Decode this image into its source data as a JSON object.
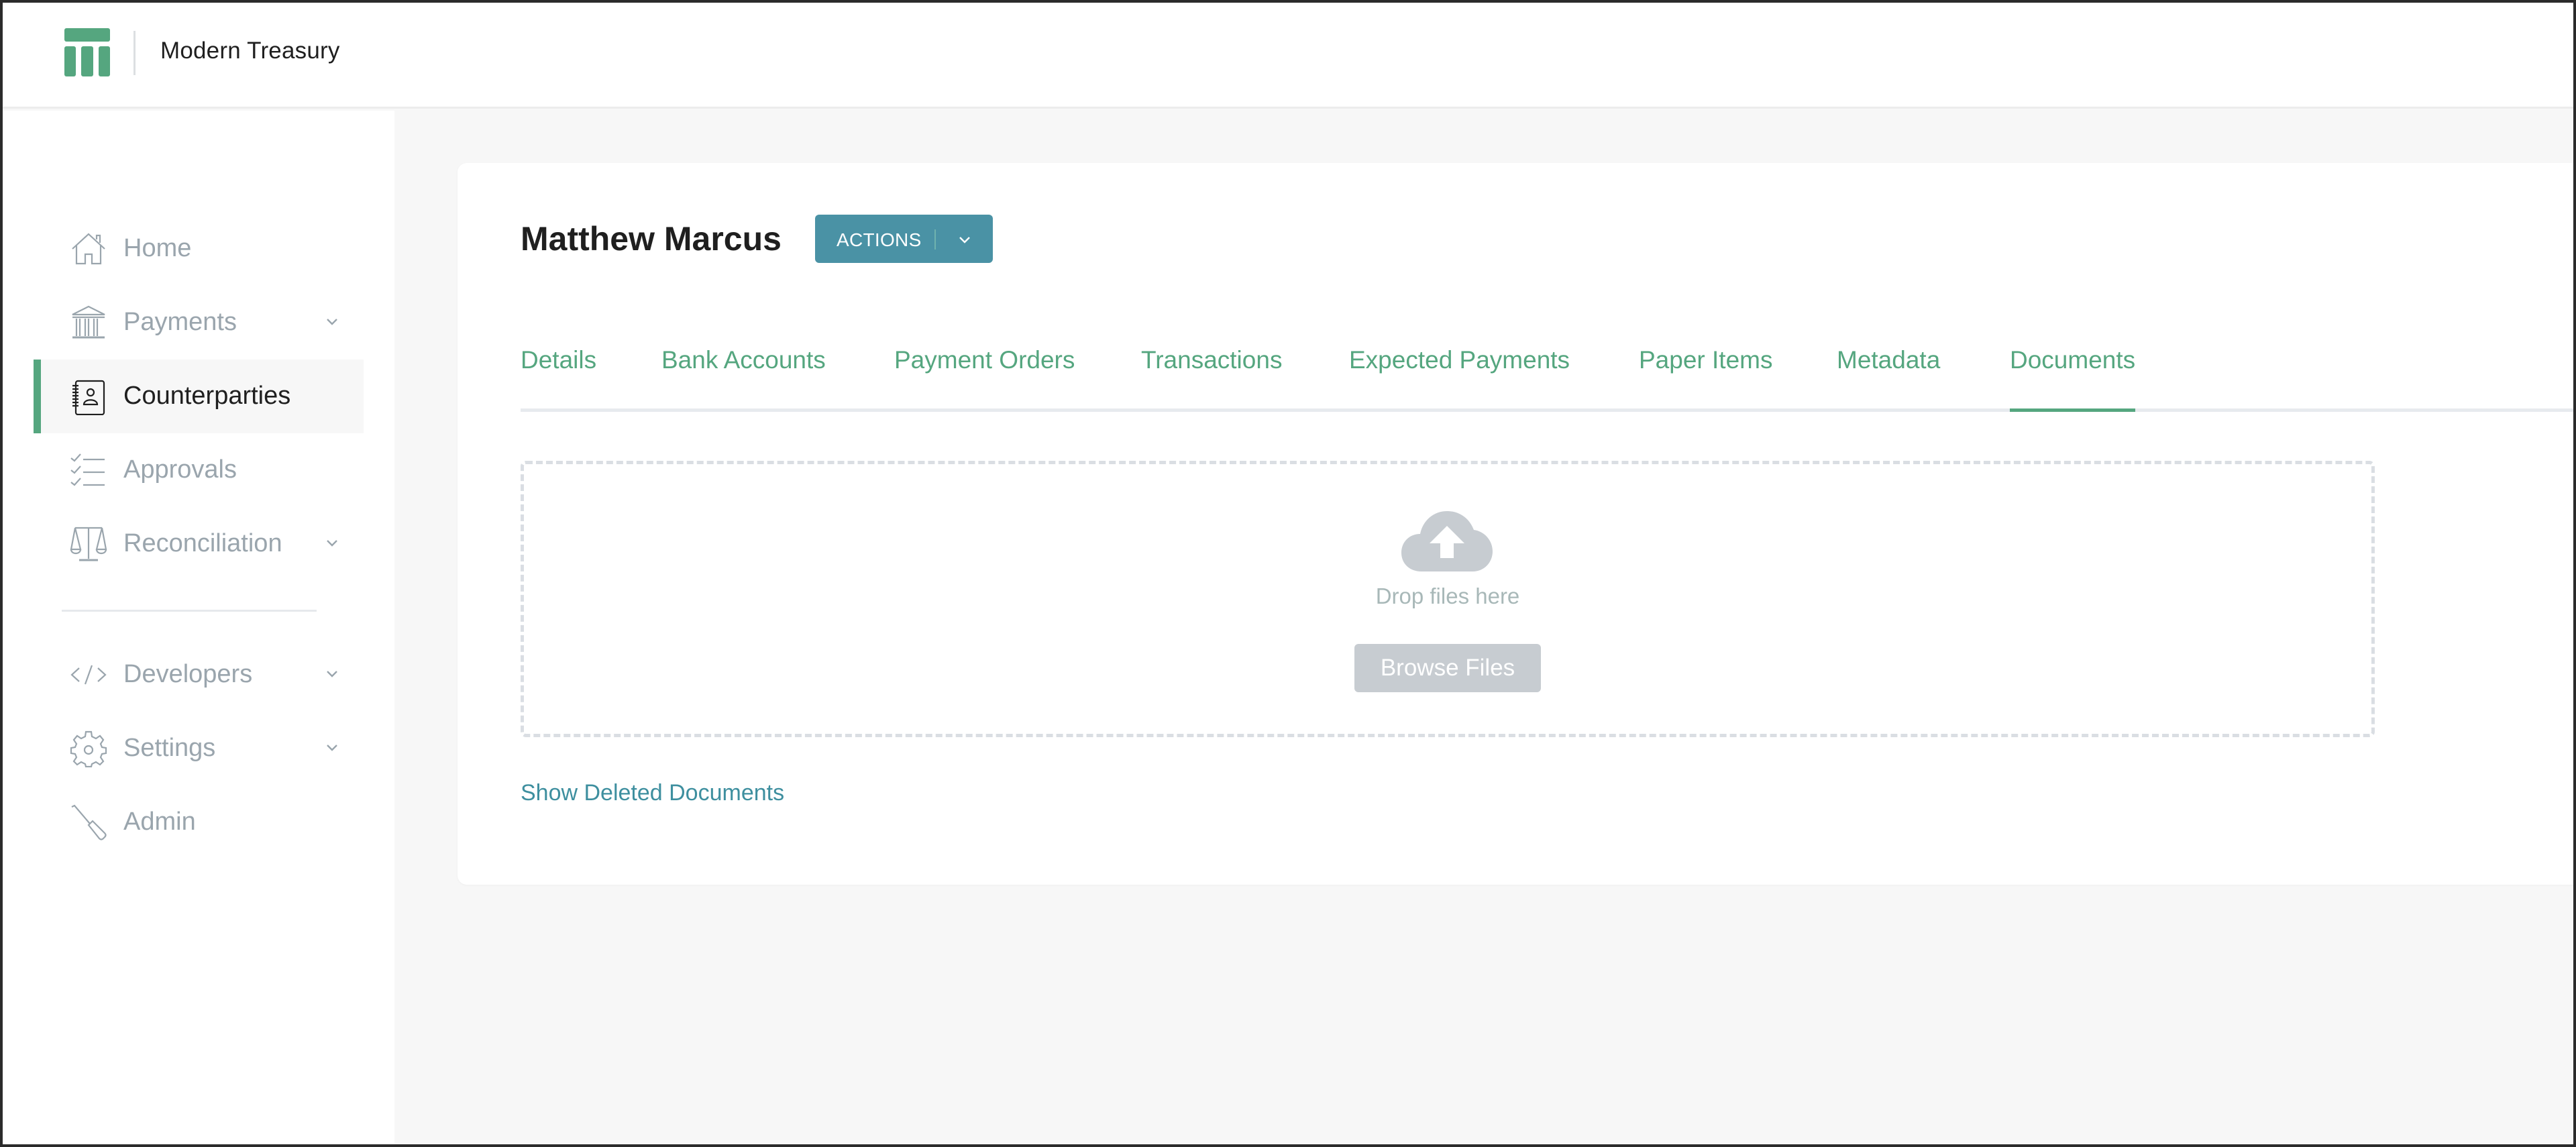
{
  "header": {
    "brand": "Modern Treasury",
    "logo_icon": "modern-treasury-logo"
  },
  "sidebar": {
    "items": [
      {
        "label": "Home",
        "icon": "home-icon",
        "has_chevron": false,
        "active": false
      },
      {
        "label": "Payments",
        "icon": "bank-icon",
        "has_chevron": true,
        "active": false
      },
      {
        "label": "Counterparties",
        "icon": "address-book-icon",
        "has_chevron": false,
        "active": true
      },
      {
        "label": "Approvals",
        "icon": "checklist-icon",
        "has_chevron": false,
        "active": false
      },
      {
        "label": "Reconciliation",
        "icon": "scales-icon",
        "has_chevron": true,
        "active": false
      },
      {
        "label": "Developers",
        "icon": "code-icon",
        "has_chevron": true,
        "active": false
      },
      {
        "label": "Settings",
        "icon": "gear-icon",
        "has_chevron": true,
        "active": false
      },
      {
        "label": "Admin",
        "icon": "screwdriver-icon",
        "has_chevron": false,
        "active": false
      }
    ]
  },
  "main": {
    "title": "Matthew Marcus",
    "actions_label": "ACTIONS",
    "tabs": [
      {
        "label": "Details",
        "active": false
      },
      {
        "label": "Bank Accounts",
        "active": false
      },
      {
        "label": "Payment Orders",
        "active": false
      },
      {
        "label": "Transactions",
        "active": false
      },
      {
        "label": "Expected Payments",
        "active": false
      },
      {
        "label": "Paper Items",
        "active": false
      },
      {
        "label": "Metadata",
        "active": false
      },
      {
        "label": "Documents",
        "active": true
      }
    ],
    "dropzone": {
      "icon": "cloud-upload-icon",
      "text": "Drop files here",
      "browse_label": "Browse Files"
    },
    "show_deleted_label": "Show Deleted Documents"
  },
  "colors": {
    "brand_green": "#55a67f",
    "actions_teal": "#4a92a5",
    "link_teal": "#3e8f9f",
    "muted_gray": "#9aa5ad",
    "background": "#f7f7f7"
  }
}
